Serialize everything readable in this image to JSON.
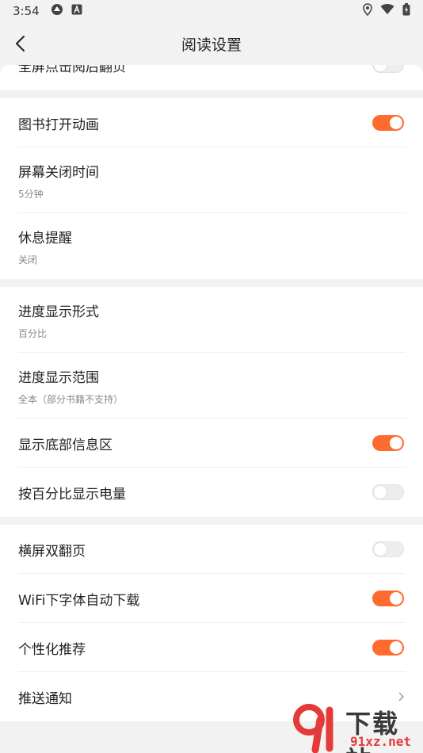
{
  "status_bar": {
    "time": "3:54",
    "icons_left": [
      "location-share-icon",
      "a-box-icon"
    ],
    "icons_right": [
      "location-icon",
      "wifi-icon",
      "battery-icon"
    ]
  },
  "header": {
    "title": "阅读设置"
  },
  "partial_row": {
    "label": "全屏点击阅后翻页",
    "toggle_state": "off"
  },
  "section1": [
    {
      "label": "图书打开动画",
      "control": "toggle",
      "state": "on"
    },
    {
      "label": "屏幕关闭时间",
      "sub": "5分钟"
    },
    {
      "label": "休息提醒",
      "sub": "关闭"
    }
  ],
  "section2": [
    {
      "label": "进度显示形式",
      "sub": "百分比"
    },
    {
      "label": "进度显示范围",
      "sub": "全本（部分书籍不支持）"
    },
    {
      "label": "显示底部信息区",
      "control": "toggle",
      "state": "on"
    },
    {
      "label": "按百分比显示电量",
      "control": "toggle",
      "state": "off"
    }
  ],
  "section3": [
    {
      "label": "横屏双翻页",
      "control": "toggle",
      "state": "off"
    },
    {
      "label": "WiFi下字体自动下载",
      "control": "toggle",
      "state": "on"
    },
    {
      "label": "个性化推荐",
      "control": "toggle",
      "state": "on"
    },
    {
      "label": "推送通知",
      "control": "chevron"
    }
  ],
  "watermark": {
    "big": "下载站",
    "small": "91xz.net"
  },
  "colors": {
    "accent": "#ff6a2e",
    "background": "#f2f2f2",
    "card": "#ffffff",
    "watermark_red": "#e53a3a"
  }
}
